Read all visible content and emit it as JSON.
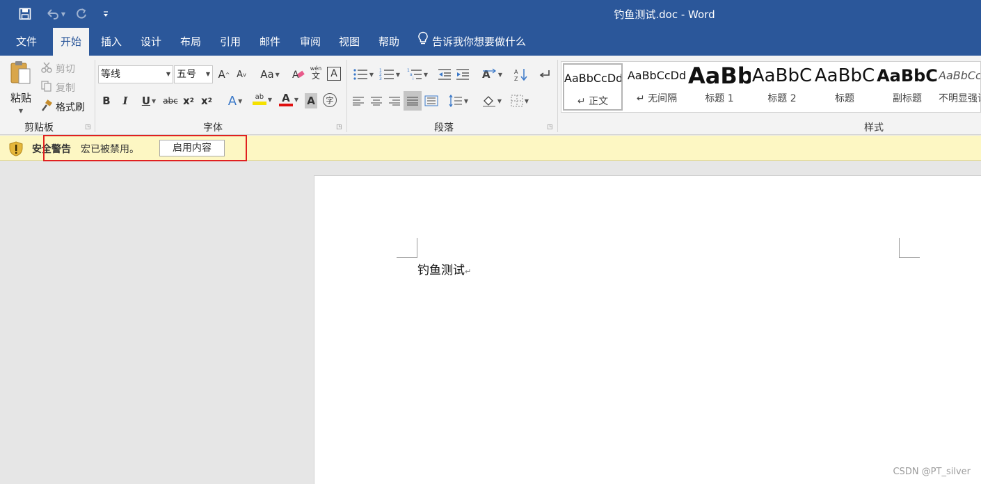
{
  "window": {
    "title": "钓鱼测试.doc  -  Word"
  },
  "quick_access": {
    "save_icon": "save-icon",
    "undo_icon": "undo-icon",
    "redo_icon": "redo-icon",
    "customize_icon": "customize-icon"
  },
  "tabs": [
    {
      "label": "文件"
    },
    {
      "label": "开始",
      "active": true
    },
    {
      "label": "插入"
    },
    {
      "label": "设计"
    },
    {
      "label": "布局"
    },
    {
      "label": "引用"
    },
    {
      "label": "邮件"
    },
    {
      "label": "审阅"
    },
    {
      "label": "视图"
    },
    {
      "label": "帮助"
    }
  ],
  "tell_me": "告诉我你想要做什么",
  "clipboard": {
    "paste": "粘贴",
    "cut": "剪切",
    "copy": "复制",
    "format_painter": "格式刷",
    "group_label": "剪贴板"
  },
  "font": {
    "font_name": "等线",
    "font_size": "五号",
    "grow": "A",
    "shrink": "A",
    "change_case": "Aa",
    "phonetic": "wén",
    "phonetic_char": "文",
    "border_char": "A",
    "bold": "B",
    "italic": "I",
    "underline": "U",
    "strike": "abc",
    "sub": "x",
    "sub_digit": "2",
    "sup": "x",
    "sup_digit": "2",
    "effects": "A",
    "highlight": "ab",
    "color": "A",
    "shading": "A",
    "enclose": "字",
    "group_label": "字体"
  },
  "paragraph": {
    "group_label": "段落"
  },
  "styles": {
    "items": [
      {
        "sample": "AaBbCcDd",
        "name": "↵ 正文",
        "size": 16,
        "weight": "normal"
      },
      {
        "sample": "AaBbCcDd",
        "name": "↵ 无间隔",
        "size": 16,
        "weight": "normal"
      },
      {
        "sample": "AaBb",
        "name": "标题 1",
        "size": 32,
        "weight": "bold"
      },
      {
        "sample": "AaBbC",
        "name": "标题 2",
        "size": 26,
        "weight": "normal"
      },
      {
        "sample": "AaBbC",
        "name": "标题",
        "size": 26,
        "weight": "normal"
      },
      {
        "sample": "AaBbC",
        "name": "副标题",
        "size": 24,
        "weight": "bold"
      },
      {
        "sample": "AaBbCcDd",
        "name": "不明显强调",
        "size": 16,
        "weight": "normal"
      }
    ],
    "group_label": "样式"
  },
  "security_bar": {
    "title": "安全警告",
    "message": "宏已被禁用。",
    "button": "启用内容"
  },
  "document": {
    "text": "钓鱼测试",
    "para_mark": "↵"
  },
  "watermark": "CSDN @PT_silver",
  "colors": {
    "titlebar": "#2b579a",
    "security_bar": "#fdf7c3",
    "highlight_box": "#e02020",
    "font_color_underline": "#e01010",
    "highlight_color": "#f5e100"
  }
}
